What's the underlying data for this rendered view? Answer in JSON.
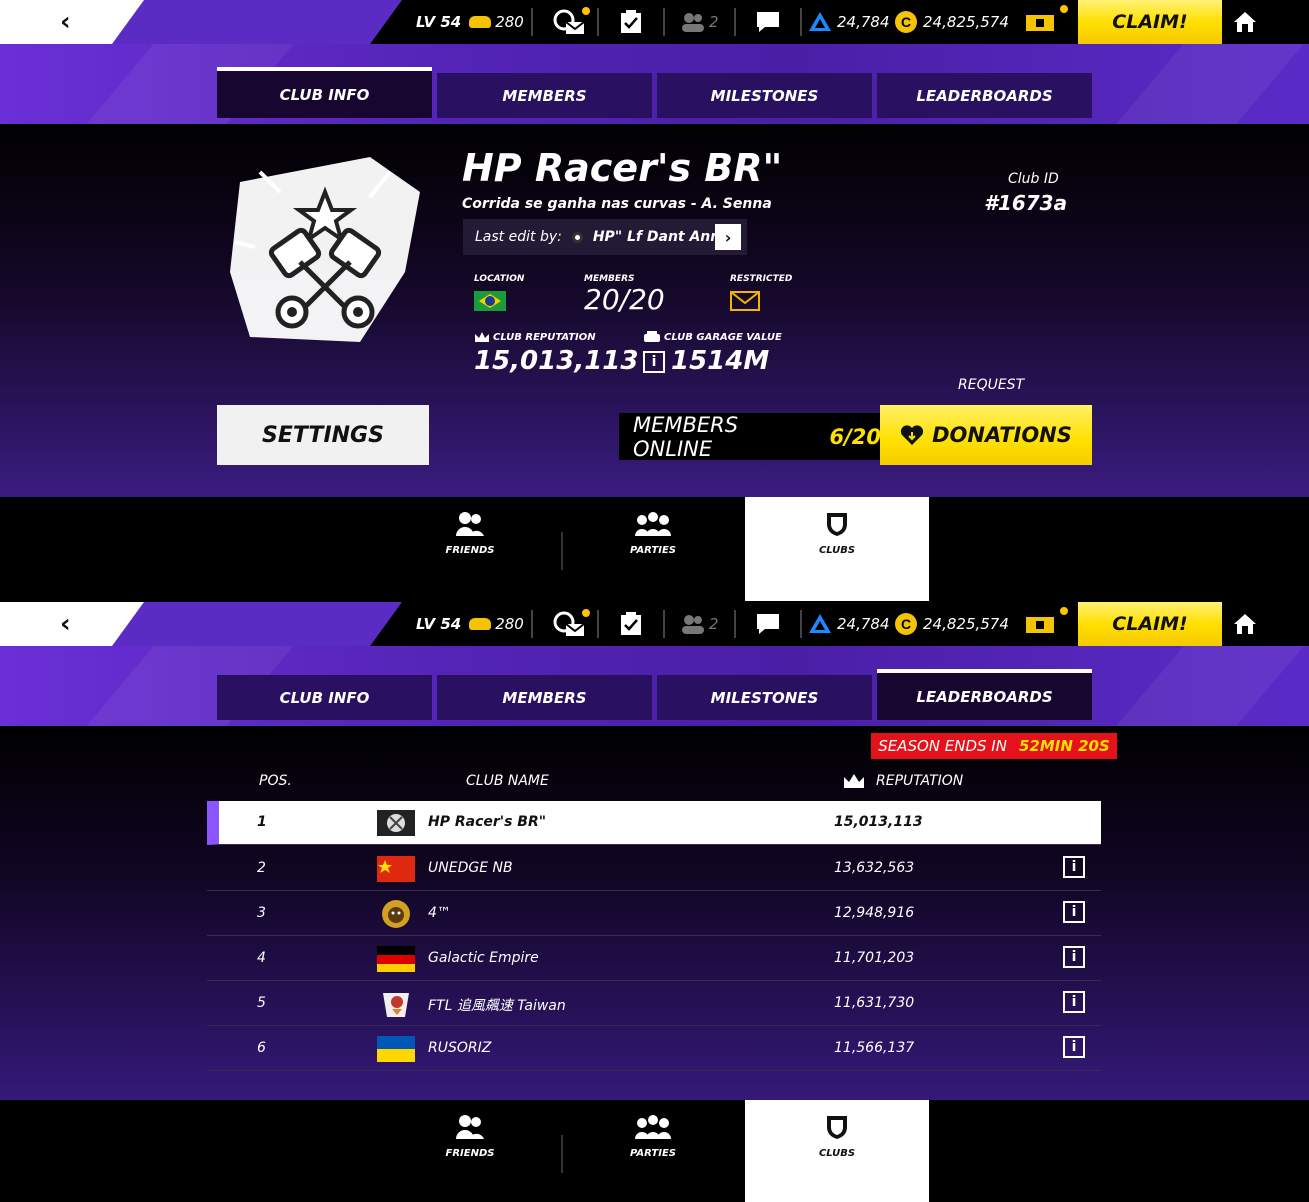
{
  "topbar": {
    "level_label": "LV 54",
    "cars": "280",
    "friends_count": "2",
    "tokens": "24,784",
    "credits": "24,825,574",
    "claim_label": "CLAIM!"
  },
  "tabs": [
    "CLUB INFO",
    "MEMBERS",
    "MILESTONES",
    "LEADERBOARDS"
  ],
  "club": {
    "name": "HP Racer's BR\"",
    "motto": "Corrida se ganha nas curvas - A. Senna",
    "last_edit_label": "Last edit by:",
    "last_edit_user": "HP\" Lf Dant Ann",
    "id_label": "Club ID",
    "id_value": "#1673a",
    "location_label": "LOCATION",
    "members_label": "MEMBERS",
    "members_value": "20/20",
    "restricted_label": "RESTRICTED",
    "reputation_label": "CLUB REPUTATION",
    "reputation_value": "15,013,113",
    "garage_label": "CLUB GARAGE VALUE",
    "garage_value": "1514M",
    "info_glyph": "i",
    "request_label": "REQUEST",
    "settings_label": "SETTINGS",
    "members_online_label": "MEMBERS ONLINE",
    "members_online_value": "6/20",
    "donations_label": "DONATIONS"
  },
  "bottomnav": {
    "friends": "FRIENDS",
    "parties": "PARTIES",
    "clubs": "CLUBS"
  },
  "leaderboard": {
    "season_label": "SEASON ENDS IN",
    "season_time": "52MIN 20S",
    "col_pos": "POS.",
    "col_name": "CLUB NAME",
    "col_rep": "REPUTATION",
    "rows": [
      {
        "pos": "1",
        "name": "HP Racer's BR\"",
        "rep": "15,013,113"
      },
      {
        "pos": "2",
        "name": "UNEDGE NB",
        "rep": "13,632,563"
      },
      {
        "pos": "3",
        "name": "4™",
        "rep": "12,948,916"
      },
      {
        "pos": "4",
        "name": "Galactic Empire",
        "rep": "11,701,203"
      },
      {
        "pos": "5",
        "name": "FTL 追風飆速 Taiwan",
        "rep": "11,631,730"
      },
      {
        "pos": "6",
        "name": "RUSORIZ",
        "rep": "11,566,137"
      }
    ]
  },
  "colors": {
    "accent_yellow": "#ffe000",
    "purple": "#4a1fa6",
    "season_red": "#e3121b"
  }
}
